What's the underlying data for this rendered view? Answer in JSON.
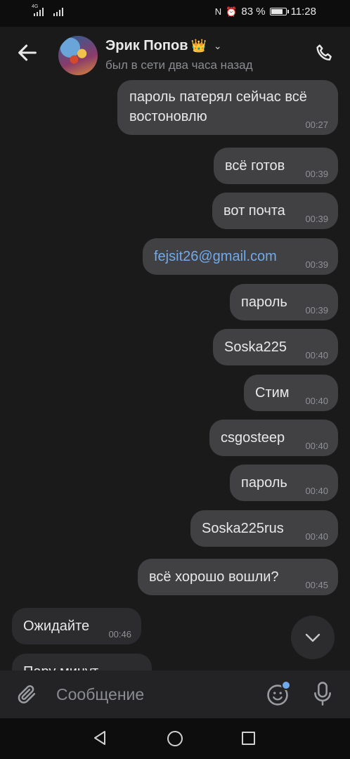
{
  "status_bar": {
    "network_label": "4G",
    "battery": "83 %",
    "battery_level": 0.83,
    "time": "11:28"
  },
  "header": {
    "contact_name": "Эрик Попов",
    "badge_icon": "crown-icon",
    "last_seen": "был в сети два часа назад"
  },
  "messages": [
    {
      "direction": "out",
      "lines": [
        "пароль патерял сейчас всё",
        "востоновлю"
      ],
      "time": "00:27"
    },
    {
      "direction": "out",
      "text": "всё готов",
      "time": "00:39"
    },
    {
      "direction": "out",
      "text": "вот почта",
      "time": "00:39"
    },
    {
      "direction": "out",
      "text": "fejsit26@gmail.com",
      "time": "00:39",
      "is_link": true
    },
    {
      "direction": "out",
      "text": "пароль",
      "time": "00:39"
    },
    {
      "direction": "out",
      "text": "Soska225",
      "time": "00:40"
    },
    {
      "direction": "out",
      "text": "Стим",
      "time": "00:40"
    },
    {
      "direction": "out",
      "text": "csgosteep",
      "time": "00:40"
    },
    {
      "direction": "out",
      "text": "пароль",
      "time": "00:40"
    },
    {
      "direction": "out",
      "text": "Soska225rus",
      "time": "00:40"
    },
    {
      "direction": "out",
      "text": "всё хорошо вошли?",
      "time": "00:45"
    },
    {
      "direction": "in",
      "text": "Ожидайте",
      "time": "00:46"
    },
    {
      "direction": "in",
      "text": "Пару минут",
      "time": ""
    }
  ],
  "composer": {
    "placeholder": "Сообщение"
  },
  "colors": {
    "background": "#1a1a1b",
    "outgoing_bubble": "#414143",
    "incoming_bubble": "#2c2c2e",
    "link": "#71aaeb",
    "secondary_text": "#8a8c90"
  }
}
